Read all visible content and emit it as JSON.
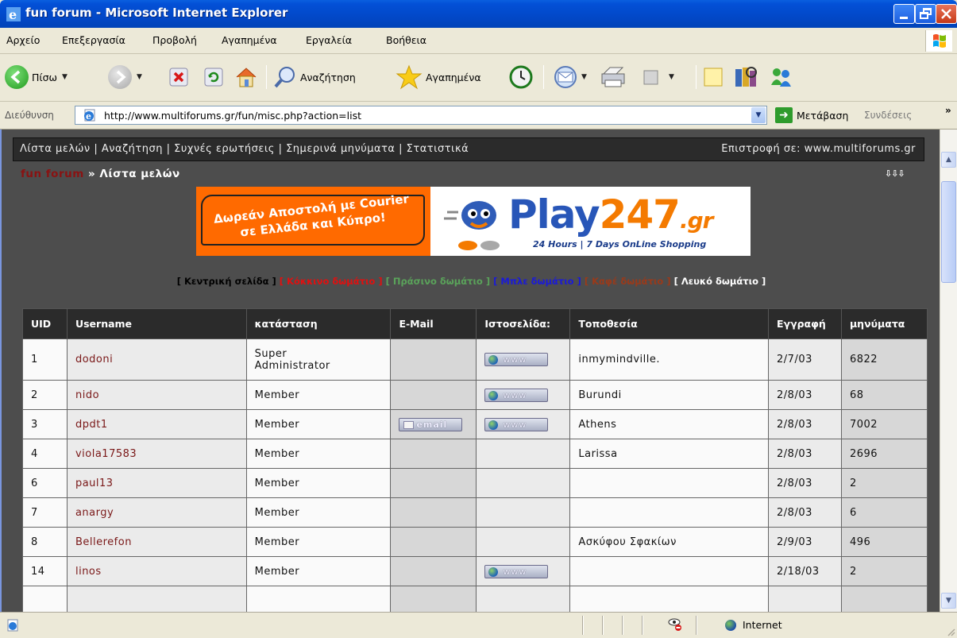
{
  "window": {
    "title": "fun forum - Microsoft Internet Explorer"
  },
  "menu": {
    "items": [
      "Αρχείο",
      "Επεξεργασία",
      "Προβολή",
      "Αγαπημένα",
      "Εργαλεία",
      "Βοήθεια"
    ]
  },
  "toolbar": {
    "back_label": "Πίσω",
    "search_label": "Αναζήτηση",
    "favorites_label": "Αγαπημένα"
  },
  "address": {
    "label": "Διεύθυνση",
    "url": "http://www.multiforums.gr/fun/misc.php?action=list",
    "go_label": "Μετάβαση",
    "links_label": "Συνδέσεις"
  },
  "forum": {
    "nav_links": [
      "Λίστα μελών",
      "Αναζήτηση",
      "Συχνές ερωτήσεις",
      "Σημερινά μηνύματα",
      "Στατιστικά"
    ],
    "back_to": "Επιστροφή σε: www.multiforums.gr",
    "breadcrumb_home": "fun forum",
    "breadcrumb_sep": "»",
    "breadcrumb_current": "Λίστα μελών",
    "banner": {
      "promo_line1": "Δωρεάν Αποστολή με Courier",
      "promo_line2": "σε Ελλάδα και Κύπρο!",
      "brand_main": "Play",
      "brand_num": "247",
      "brand_tld": ".gr",
      "tagline": "24 Hours | 7 Days OnLine Shopping"
    },
    "rooms": [
      {
        "label": "Κεντρική σελίδα",
        "color": "#000000"
      },
      {
        "label": "Κόκκινο δωμάτιο",
        "color": "#e01010"
      },
      {
        "label": "Πράσινο δωμάτιο",
        "color": "#5aa35a"
      },
      {
        "label": "Μπλε δωμάτιο",
        "color": "#1a1ad8"
      },
      {
        "label": "Καφέ δωμάτιο",
        "color": "#9a3a1a"
      },
      {
        "label": "Λευκό δωμάτιο",
        "color": "#ffffff"
      }
    ]
  },
  "table": {
    "headers": [
      "UID",
      "Username",
      "κατάσταση",
      "E-Mail",
      "Ιστοσελίδα:",
      "Τοποθεσία",
      "Εγγραφή",
      "μηνύματα"
    ],
    "email_btn": "email",
    "www_btn": "www",
    "rows": [
      {
        "uid": "1",
        "username": "dodoni",
        "status_line1": "Super",
        "status_line2": "Administrator",
        "email": false,
        "www": true,
        "location": "inmymindville.",
        "joined": "2/7/03",
        "posts": "6822"
      },
      {
        "uid": "2",
        "username": "nido",
        "status_line1": "Member",
        "status_line2": "",
        "email": false,
        "www": true,
        "location": "Burundi",
        "joined": "2/8/03",
        "posts": "68"
      },
      {
        "uid": "3",
        "username": "dpdt1",
        "status_line1": "Member",
        "status_line2": "",
        "email": true,
        "www": true,
        "location": "Athens",
        "joined": "2/8/03",
        "posts": "7002"
      },
      {
        "uid": "4",
        "username": "viola17583",
        "status_line1": "Member",
        "status_line2": "",
        "email": false,
        "www": false,
        "location": "Larissa",
        "joined": "2/8/03",
        "posts": "2696"
      },
      {
        "uid": "6",
        "username": "paul13",
        "status_line1": "Member",
        "status_line2": "",
        "email": false,
        "www": false,
        "location": "",
        "joined": "2/8/03",
        "posts": "2"
      },
      {
        "uid": "7",
        "username": "anargy",
        "status_line1": "Member",
        "status_line2": "",
        "email": false,
        "www": false,
        "location": "",
        "joined": "2/8/03",
        "posts": "6"
      },
      {
        "uid": "8",
        "username": "Bellerefon",
        "status_line1": "Member",
        "status_line2": "",
        "email": false,
        "www": false,
        "location": "Ασκύφου Σφακίων",
        "joined": "2/9/03",
        "posts": "496"
      },
      {
        "uid": "14",
        "username": "linos",
        "status_line1": "Member",
        "status_line2": "",
        "email": false,
        "www": true,
        "location": "",
        "joined": "2/18/03",
        "posts": "2"
      }
    ]
  },
  "statusbar": {
    "zone": "Internet"
  }
}
